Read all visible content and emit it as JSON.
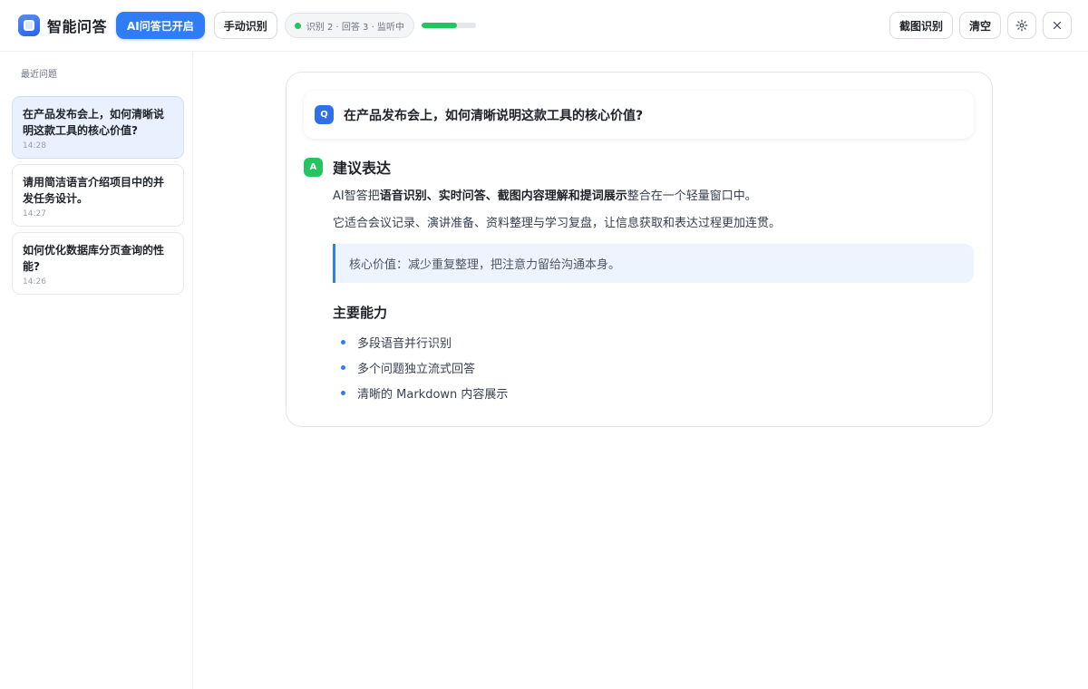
{
  "header": {
    "app_title": "智能问答",
    "ai_toggle_label": "AI问答已开启",
    "manual_button_label": "手动识别",
    "status_text": "识别 2 · 回答 3 · 监听中",
    "progress_value": 0.65,
    "screenshot_button_label": "截图识别",
    "clear_button_label": "清空",
    "settings_icon": "gear-icon",
    "close_icon": "close-icon",
    "status_color": "#22c55e",
    "accent_color": "#2f7df6"
  },
  "sidebar": {
    "heading": "最近问题",
    "items": [
      {
        "question": "在产品发布会上，如何清晰说明这款工具的核心价值?",
        "time": "14:28",
        "active": true
      },
      {
        "question": "请用简洁语言介绍项目中的并发任务设计。",
        "time": "14:27",
        "active": false
      },
      {
        "question": "如何优化数据库分页查询的性能?",
        "time": "14:26",
        "active": false
      }
    ]
  },
  "main": {
    "question_badge": "Q",
    "question": "在产品发布会上，如何清晰说明这款工具的核心价值?",
    "answer_badge": "A",
    "answer_title": "建议表达",
    "para1_prefix": "AI智答把",
    "para1_bold": "语音识别、实时问答、截图内容理解和提词展示",
    "para1_suffix": "整合在一个轻量窗口中。",
    "para2": "它适合会议记录、演讲准备、资料整理与学习复盘，让信息获取和表达过程更加连贯。",
    "quote": "核心价值：减少重复整理，把注意力留给沟通本身。",
    "section_title": "主要能力",
    "bullets": [
      "多段语音并行识别",
      "多个问题独立流式回答",
      "清晰的 Markdown 内容展示"
    ]
  }
}
